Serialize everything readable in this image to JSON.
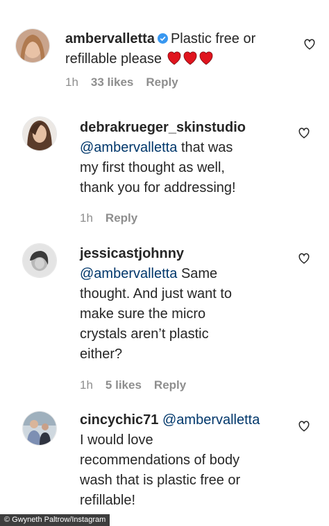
{
  "comments": [
    {
      "username": "ambervalletta",
      "verified": true,
      "text_lines": [
        "Plastic free or",
        "refillable please"
      ],
      "hearts": 3,
      "time": "1h",
      "likes": "33 likes",
      "reply": "Reply"
    },
    {
      "username": "debrakrueger_skinstudio",
      "mention": "@ambervalletta",
      "text_first": "that was",
      "text_lines": [
        "my first thought as well,",
        "thank you for addressing!"
      ],
      "time": "1h",
      "reply": "Reply"
    },
    {
      "username": "jessicastjohnny",
      "mention": "@ambervalletta",
      "text_first": "Same",
      "text_lines": [
        "thought. And just want to",
        "make sure the micro",
        "crystals aren’t plastic",
        "either?"
      ],
      "time": "1h",
      "likes": "5 likes",
      "reply": "Reply"
    },
    {
      "username": "cincychic71",
      "mention": "@ambervalletta",
      "text_lines": [
        "I would love",
        "recommendations of body",
        "wash that is plastic free or",
        "refillable!"
      ]
    }
  ],
  "watermark": "© Gwyneth Paltrow/Instagram",
  "colors": {
    "heart_red": "#e0141e",
    "verified_blue": "#3897f0",
    "mention": "#00376b",
    "meta": "#8e8e8e"
  },
  "icons": {
    "like": "heart-outline-icon",
    "verified": "verified-badge-icon",
    "emoji": "red-heart-emoji"
  }
}
